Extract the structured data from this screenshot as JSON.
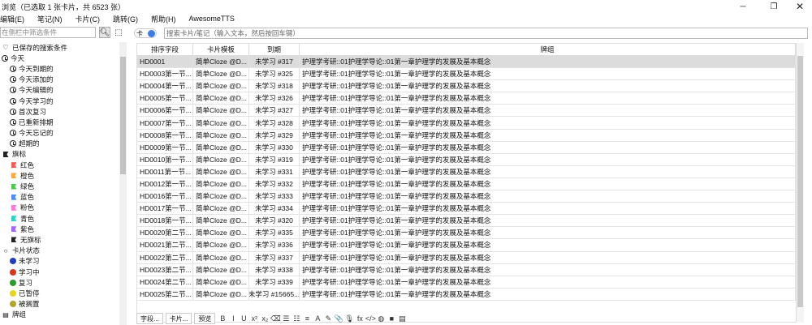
{
  "window": {
    "title": "浏览（已选取 1 张卡片，共 6523 张）",
    "minimize": "─",
    "maximize": "❐",
    "close": "✕"
  },
  "menu": [
    "编辑(E)",
    "笔记(N)",
    "卡片(C)",
    "跳转(G)",
    "帮助(H)",
    "AwesomeTTS"
  ],
  "sidebar": {
    "search_placeholder": "在侧栏中筛选条件",
    "items": [
      {
        "label": "已保存的搜索条件",
        "icon": "heart-icon",
        "level": 0
      },
      {
        "label": "今天",
        "icon": "clock-icon",
        "level": 0
      },
      {
        "label": "今天到期的",
        "icon": "clock-icon",
        "level": 1
      },
      {
        "label": "今天添加的",
        "icon": "clock-icon",
        "level": 1
      },
      {
        "label": "今天编辑的",
        "icon": "clock-icon",
        "level": 1
      },
      {
        "label": "今天学习的",
        "icon": "clock-icon",
        "level": 1
      },
      {
        "label": "首次复习",
        "icon": "clock-icon",
        "level": 1
      },
      {
        "label": "已重新排期",
        "icon": "clock-icon",
        "level": 1
      },
      {
        "label": "今天忘记的",
        "icon": "clock-icon",
        "level": 1
      },
      {
        "label": "超期的",
        "icon": "clock-icon",
        "level": 1
      },
      {
        "label": "旗标",
        "icon": "flag-icon",
        "level": 0,
        "color": "#222222"
      },
      {
        "label": "红色",
        "icon": "flag-icon",
        "level": 1,
        "color": "#ff5a5a"
      },
      {
        "label": "橙色",
        "icon": "flag-icon",
        "level": 1,
        "color": "#ffa640"
      },
      {
        "label": "绿色",
        "icon": "flag-icon",
        "level": 1,
        "color": "#4cc94c"
      },
      {
        "label": "蓝色",
        "icon": "flag-icon",
        "level": 1,
        "color": "#4a8cff"
      },
      {
        "label": "粉色",
        "icon": "flag-icon",
        "level": 1,
        "color": "#ff7ad9"
      },
      {
        "label": "青色",
        "icon": "flag-icon",
        "level": 1,
        "color": "#2ed3c7"
      },
      {
        "label": "紫色",
        "icon": "flag-icon",
        "level": 1,
        "color": "#a066ff"
      },
      {
        "label": "无旗标",
        "icon": "flag-icon",
        "level": 1,
        "color": "#222222"
      },
      {
        "label": "卡片状态",
        "icon": "circle-icon",
        "level": 0
      },
      {
        "label": "未学习",
        "icon": "dot-icon",
        "level": 1,
        "color": "#1f3fbf"
      },
      {
        "label": "学习中",
        "icon": "dot-icon",
        "level": 1,
        "color": "#d9351e"
      },
      {
        "label": "复习",
        "icon": "dot-icon",
        "level": 1,
        "color": "#2c9a2c"
      },
      {
        "label": "已暂停",
        "icon": "dot-icon",
        "level": 1,
        "color": "#e6d520"
      },
      {
        "label": "被搁置",
        "icon": "dot-icon",
        "level": 1,
        "color": "#b2a42e"
      },
      {
        "label": "牌组",
        "icon": "deck-icon",
        "level": 0
      }
    ]
  },
  "main": {
    "toggle_label": "卡",
    "search_placeholder": "搜索卡片/笔记（输入文本，然后按回车键）",
    "columns": [
      "排序字段",
      "卡片模板",
      "到期",
      "牌组"
    ],
    "rows": [
      {
        "sort": "HD0001",
        "template": "简单Cloze @D...",
        "due": "未学习 #317",
        "deck": "护理学考研::01护理学导论::01第一章护理学的发展及基本概念",
        "selected": true
      },
      {
        "sort": "HD0003第一节...",
        "template": "简单Cloze @D...",
        "due": "未学习 #325",
        "deck": "护理学考研::01护理学导论::01第一章护理学的发展及基本概念"
      },
      {
        "sort": "HD0004第一节...",
        "template": "简单Cloze @D...",
        "due": "未学习 #318",
        "deck": "护理学考研::01护理学导论::01第一章护理学的发展及基本概念"
      },
      {
        "sort": "HD0005第一节...",
        "template": "简单Cloze @D...",
        "due": "未学习 #326",
        "deck": "护理学考研::01护理学导论::01第一章护理学的发展及基本概念"
      },
      {
        "sort": "HD0006第一节...",
        "template": "简单Cloze @D...",
        "due": "未学习 #327",
        "deck": "护理学考研::01护理学导论::01第一章护理学的发展及基本概念"
      },
      {
        "sort": "HD0007第一节...",
        "template": "简单Cloze @D...",
        "due": "未学习 #328",
        "deck": "护理学考研::01护理学导论::01第一章护理学的发展及基本概念"
      },
      {
        "sort": "HD0008第一节...",
        "template": "简单Cloze @D...",
        "due": "未学习 #329",
        "deck": "护理学考研::01护理学导论::01第一章护理学的发展及基本概念"
      },
      {
        "sort": "HD0009第一节...",
        "template": "简单Cloze @D...",
        "due": "未学习 #330",
        "deck": "护理学考研::01护理学导论::01第一章护理学的发展及基本概念"
      },
      {
        "sort": "HD0010第一节...",
        "template": "简单Cloze @D...",
        "due": "未学习 #319",
        "deck": "护理学考研::01护理学导论::01第一章护理学的发展及基本概念"
      },
      {
        "sort": "HD0011第一节...",
        "template": "简单Cloze @D...",
        "due": "未学习 #331",
        "deck": "护理学考研::01护理学导论::01第一章护理学的发展及基本概念"
      },
      {
        "sort": "HD0012第一节...",
        "template": "简单Cloze @D...",
        "due": "未学习 #332",
        "deck": "护理学考研::01护理学导论::01第一章护理学的发展及基本概念"
      },
      {
        "sort": "HD0016第一节...",
        "template": "简单Cloze @D...",
        "due": "未学习 #333",
        "deck": "护理学考研::01护理学导论::01第一章护理学的发展及基本概念"
      },
      {
        "sort": "HD0017第一节...",
        "template": "简单Cloze @D...",
        "due": "未学习 #334",
        "deck": "护理学考研::01护理学导论::01第一章护理学的发展及基本概念"
      },
      {
        "sort": "HD0018第一节...",
        "template": "简单Cloze @D...",
        "due": "未学习 #320",
        "deck": "护理学考研::01护理学导论::01第一章护理学的发展及基本概念"
      },
      {
        "sort": "HD0020第二节...",
        "template": "简单Cloze @D...",
        "due": "未学习 #335",
        "deck": "护理学考研::01护理学导论::01第一章护理学的发展及基本概念"
      },
      {
        "sort": "HD0021第二节...",
        "template": "简单Cloze @D...",
        "due": "未学习 #336",
        "deck": "护理学考研::01护理学导论::01第一章护理学的发展及基本概念"
      },
      {
        "sort": "HD0022第二节...",
        "template": "简单Cloze @D...",
        "due": "未学习 #337",
        "deck": "护理学考研::01护理学导论::01第一章护理学的发展及基本概念"
      },
      {
        "sort": "HD0023第二节...",
        "template": "简单Cloze @D...",
        "due": "未学习 #338",
        "deck": "护理学考研::01护理学导论::01第一章护理学的发展及基本概念"
      },
      {
        "sort": "HD0024第二节...",
        "template": "简单Cloze @D...",
        "due": "未学习 #339",
        "deck": "护理学考研::01护理学导论::01第一章护理学的发展及基本概念"
      },
      {
        "sort": "HD0025第二节...",
        "template": "简单Cloze @D...",
        "due": "未学习 #15665...",
        "deck": "护理学考研::01护理学导论::01第一章护理学的发展及基本概念"
      }
    ]
  },
  "editor_toolbar": {
    "buttons": [
      "字段...",
      "卡片...",
      "预览"
    ],
    "format_icons": [
      "B",
      "I",
      "U",
      "x²",
      "x₂",
      "⌫",
      "☰",
      "☷",
      "≡",
      "A",
      "✎",
      "📎",
      "🎙",
      "fx",
      "</>",
      "◍",
      "■",
      "▤"
    ]
  }
}
